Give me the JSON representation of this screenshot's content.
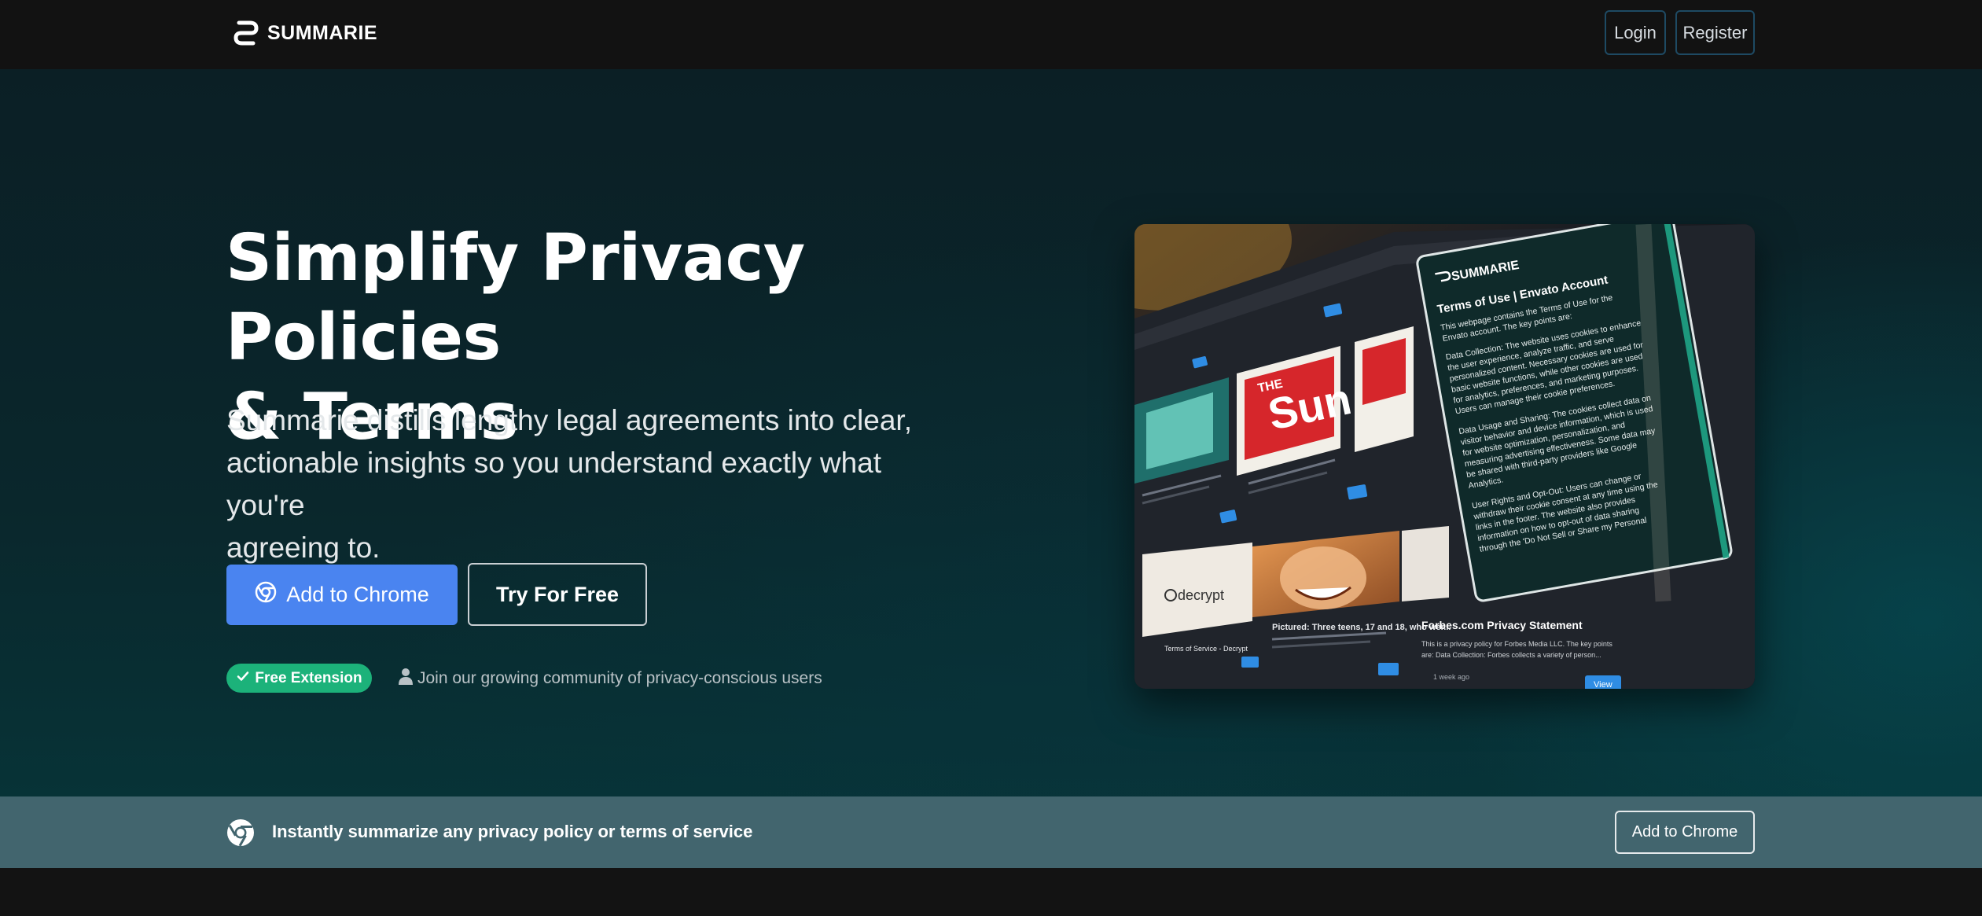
{
  "nav": {
    "brand": "SUMMARIE",
    "login_label": "Login",
    "register_label": "Register"
  },
  "hero": {
    "title_line1": "Simplify Privacy Policies",
    "title_line2": "& Terms",
    "subtitle_line1": "Summarie distills lengthy legal agreements into clear,",
    "subtitle_line2": "actionable insights so you understand exactly what you're",
    "subtitle_line3": "agreeing to.",
    "add_to_chrome_label": "Add to Chrome",
    "try_free_label": "Try For Free",
    "free_badge": "Free Extension",
    "community_text": "Join our growing community of privacy-conscious users"
  },
  "screenshot": {
    "panel_brand": "SUMMARIE",
    "panel_title": "Terms of Use | Envato Account",
    "panel_intro_1": "This webpage contains the Terms of Use for the",
    "panel_intro_2": "Envato account. The key points are:",
    "panel_p1_1": "Data Collection: The website uses cookies to enhance",
    "panel_p1_2": "the user experience, analyze traffic, and serve",
    "panel_p1_3": "personalized content. Necessary cookies are used for",
    "panel_p1_4": "basic website functions, while other cookies are used",
    "panel_p1_5": "for analytics, preferences, and marketing purposes.",
    "panel_p1_6": "Users can manage their cookie preferences.",
    "panel_p2_1": "Data Usage and Sharing: The cookies collect data on",
    "panel_p2_2": "visitor behavior and device information, which is used",
    "panel_p2_3": "for website optimization, personalization, and",
    "panel_p2_4": "measuring advertising effectiveness. Some data may",
    "panel_p2_5": "be shared with third-party providers like Google",
    "panel_p2_6": "Analytics.",
    "panel_p3_1": "User Rights and Opt-Out: Users can change or",
    "panel_p3_2": "withdraw their cookie consent at any time using the",
    "panel_p3_3": "links in the footer. The website also provides",
    "panel_p3_4": "information on how to opt-out of data sharing",
    "panel_p3_5": "through the 'Do Not Sell or Share my Personal",
    "card_sun": "Sun",
    "card_the": "THE",
    "card_decrypt": "decrypt",
    "card_forbes_title": "Forbes.com Privacy Statement",
    "card_forbes_1": "This is a privacy policy for Forbes Media LLC. The key points",
    "card_forbes_2": "are: Data Collection: Forbes collects a variety of person...",
    "card_forbes_time": "1 week ago",
    "card_pictured": "Pictured: Three teens, 17 and 18, who wer...",
    "card_terms": "Terms of Service - Decrypt",
    "view_label": "View"
  },
  "cta": {
    "text": "Instantly summarize any privacy policy or terms of service",
    "button_label": "Add to Chrome"
  },
  "colors": {
    "primary_blue": "#4a84f0",
    "success_green": "#1cb27a",
    "banner_teal": "#42656e",
    "nav_border": "#1e4a63"
  }
}
